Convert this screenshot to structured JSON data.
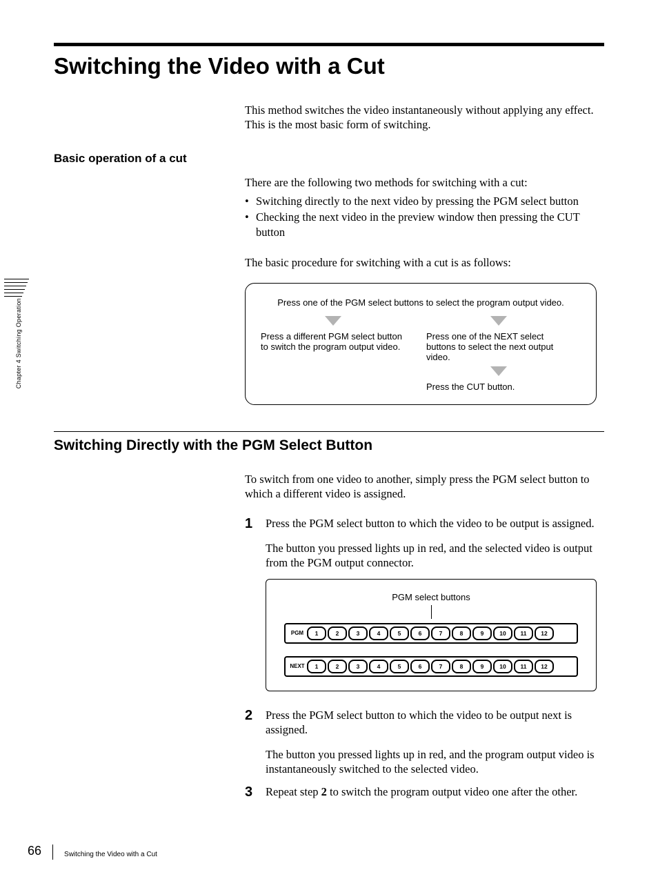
{
  "sidebar": {
    "text": "Chapter 4  Switching Operation"
  },
  "title": "Switching the Video with a Cut",
  "intro": "This method switches the video instantaneously without applying any effect. This is the most basic form of switching.",
  "basic_head": "Basic operation of a cut",
  "basic_intro": "There are the following two methods for switching with a cut:",
  "basic_bullets": [
    "Switching directly to the next video by pressing the PGM select button",
    "Checking the next video in the preview window then pressing the CUT button"
  ],
  "basic_procedure_intro": "The basic procedure for switching with a cut is as follows:",
  "flow": {
    "top": "Press one of the PGM select buttons to select the program output video.",
    "left": "Press a different PGM select button to switch the program output video.",
    "right1": "Press one of the NEXT select buttons to select the next output video.",
    "right2": "Press the CUT button."
  },
  "section2_head": "Switching Directly with the PGM Select Button",
  "section2_intro": "To switch from one video to another, simply press the PGM select button to which a different video is assigned.",
  "steps": {
    "s1_a": "Press the PGM select button to which the video to be output is assigned.",
    "s1_b": "The button you pressed lights up in red, and the selected video is output from the PGM output connector.",
    "s2_a": "Press the PGM select button to which the video to be output next is assigned.",
    "s2_b": "The button you pressed lights up in red, and the program output video is instantaneously switched to the selected video.",
    "s3_pre": "Repeat step ",
    "s3_bold": "2",
    "s3_post": " to switch the program output video one after the other."
  },
  "panel": {
    "caption": "PGM select buttons",
    "rows": [
      {
        "label": "PGM",
        "buttons": [
          "1",
          "2",
          "3",
          "4",
          "5",
          "6",
          "7",
          "8",
          "9",
          "10",
          "11",
          "12"
        ]
      },
      {
        "label": "NEXT",
        "buttons": [
          "1",
          "2",
          "3",
          "4",
          "5",
          "6",
          "7",
          "8",
          "9",
          "10",
          "11",
          "12"
        ]
      }
    ]
  },
  "footer": {
    "page": "66",
    "title": "Switching the Video with a Cut"
  }
}
